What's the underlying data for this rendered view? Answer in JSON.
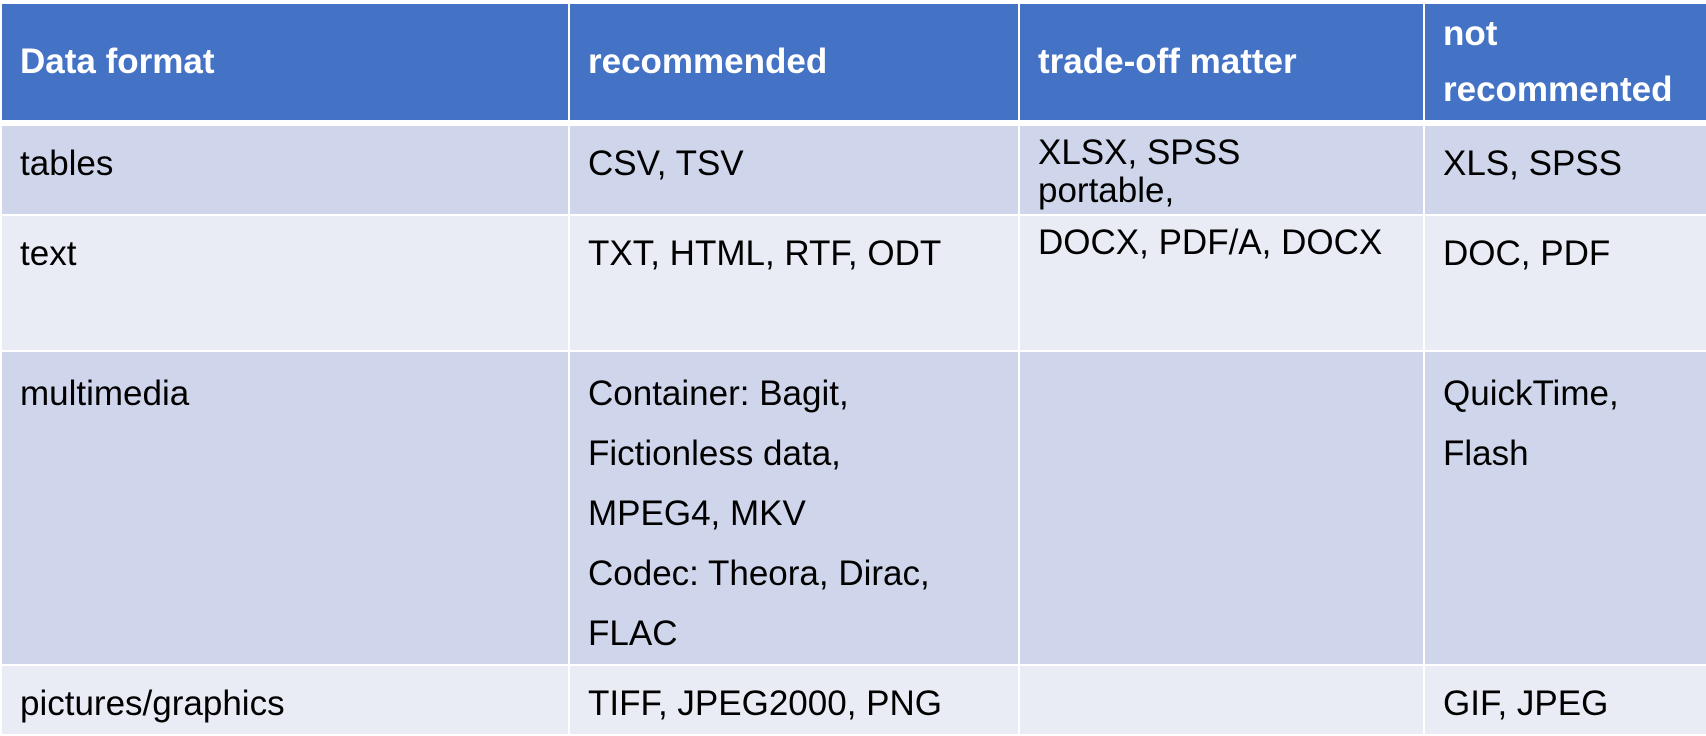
{
  "table": {
    "headers": [
      "Data format",
      "recommended",
      "trade-off matter",
      "not recommented"
    ],
    "rows": [
      {
        "format": "tables",
        "recommended": [
          "CSV, TSV"
        ],
        "tradeoff": [
          "XLSX, SPSS",
          "portable,"
        ],
        "not_recommended": [
          "XLS, SPSS"
        ]
      },
      {
        "format": "text",
        "recommended": [
          "TXT, HTML, RTF, ODT"
        ],
        "tradeoff": [
          "DOCX, PDF/A, DOCX"
        ],
        "not_recommended": [
          "DOC, PDF"
        ]
      },
      {
        "format": "multimedia",
        "recommended": [
          "Container: Bagit,",
          "Fictionless data,",
          "MPEG4, MKV",
          "Codec: Theora, Dirac,",
          "FLAC"
        ],
        "tradeoff": [],
        "not_recommended": [
          "QuickTime,",
          "Flash"
        ]
      },
      {
        "format": "pictures/graphics",
        "recommended": [
          "TIFF, JPEG2000, PNG"
        ],
        "tradeoff": [],
        "not_recommended": [
          "GIF, JPEG"
        ]
      }
    ]
  },
  "colors": {
    "header_bg": "#4472c4",
    "row_odd_bg": "#cfd5ea",
    "row_even_bg": "#e9ebf5"
  }
}
